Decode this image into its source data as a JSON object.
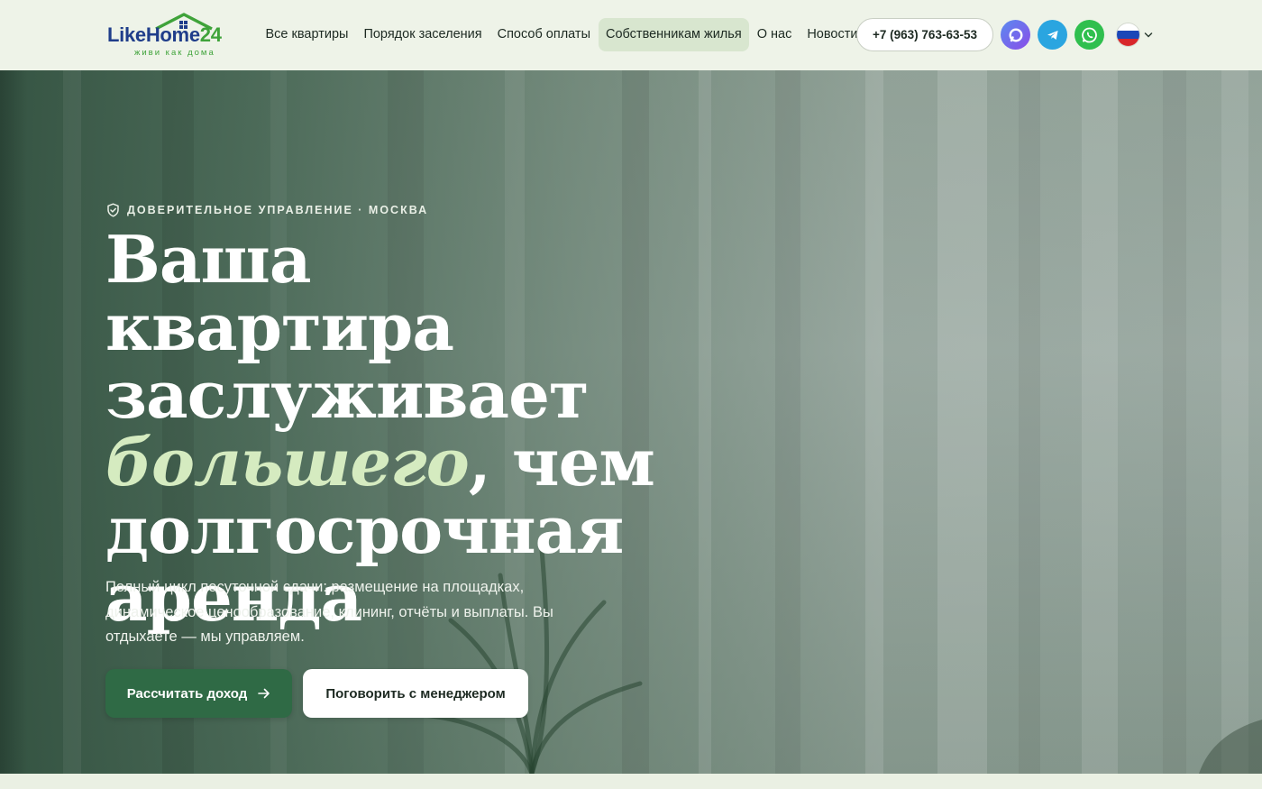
{
  "brand": {
    "name_like": "Like",
    "name_home": "Home",
    "name_num": "24",
    "tagline": "живи как дома",
    "colors": {
      "navy": "#1f3d8a",
      "green": "#3fa33a"
    }
  },
  "nav": {
    "items": [
      {
        "label": "Все квартиры",
        "active": false
      },
      {
        "label": "Порядок заселения",
        "active": false
      },
      {
        "label": "Способ оплаты",
        "active": false
      },
      {
        "label": "Собственникам жилья",
        "active": true
      },
      {
        "label": "О нас",
        "active": false
      },
      {
        "label": "Новости",
        "active": false
      }
    ]
  },
  "contacts": {
    "phone": "+7 (963) 763-63-53",
    "messengers": [
      {
        "icon": "max-messenger-icon",
        "color": "#7066ee"
      },
      {
        "icon": "telegram-icon",
        "color": "#2aa5e0"
      },
      {
        "icon": "whatsapp-icon",
        "color": "#2fbf4e"
      }
    ]
  },
  "language": {
    "current": "ru",
    "flag_icon": "russia-flag-icon"
  },
  "hero": {
    "eyebrow": "ДОВЕРИТЕЛЬНОЕ УПРАВЛЕНИЕ · МОСКВА",
    "headline_part1": "Ваша квартира заслуживает ",
    "headline_accent": "большего",
    "headline_part2": ", чем долгосрочная аренда",
    "lead": "Полный цикл посуточной сдачи: размещение на площадках, динамическое ценообразование, клининг, отчёты и выплаты. Вы отдыхаете — мы управляем.",
    "cta_primary": "Рассчитать доход",
    "cta_secondary": "Поговорить с менеджером",
    "colors": {
      "accent_text": "#d5ebc0",
      "primary_button": "#2f6a45"
    }
  }
}
